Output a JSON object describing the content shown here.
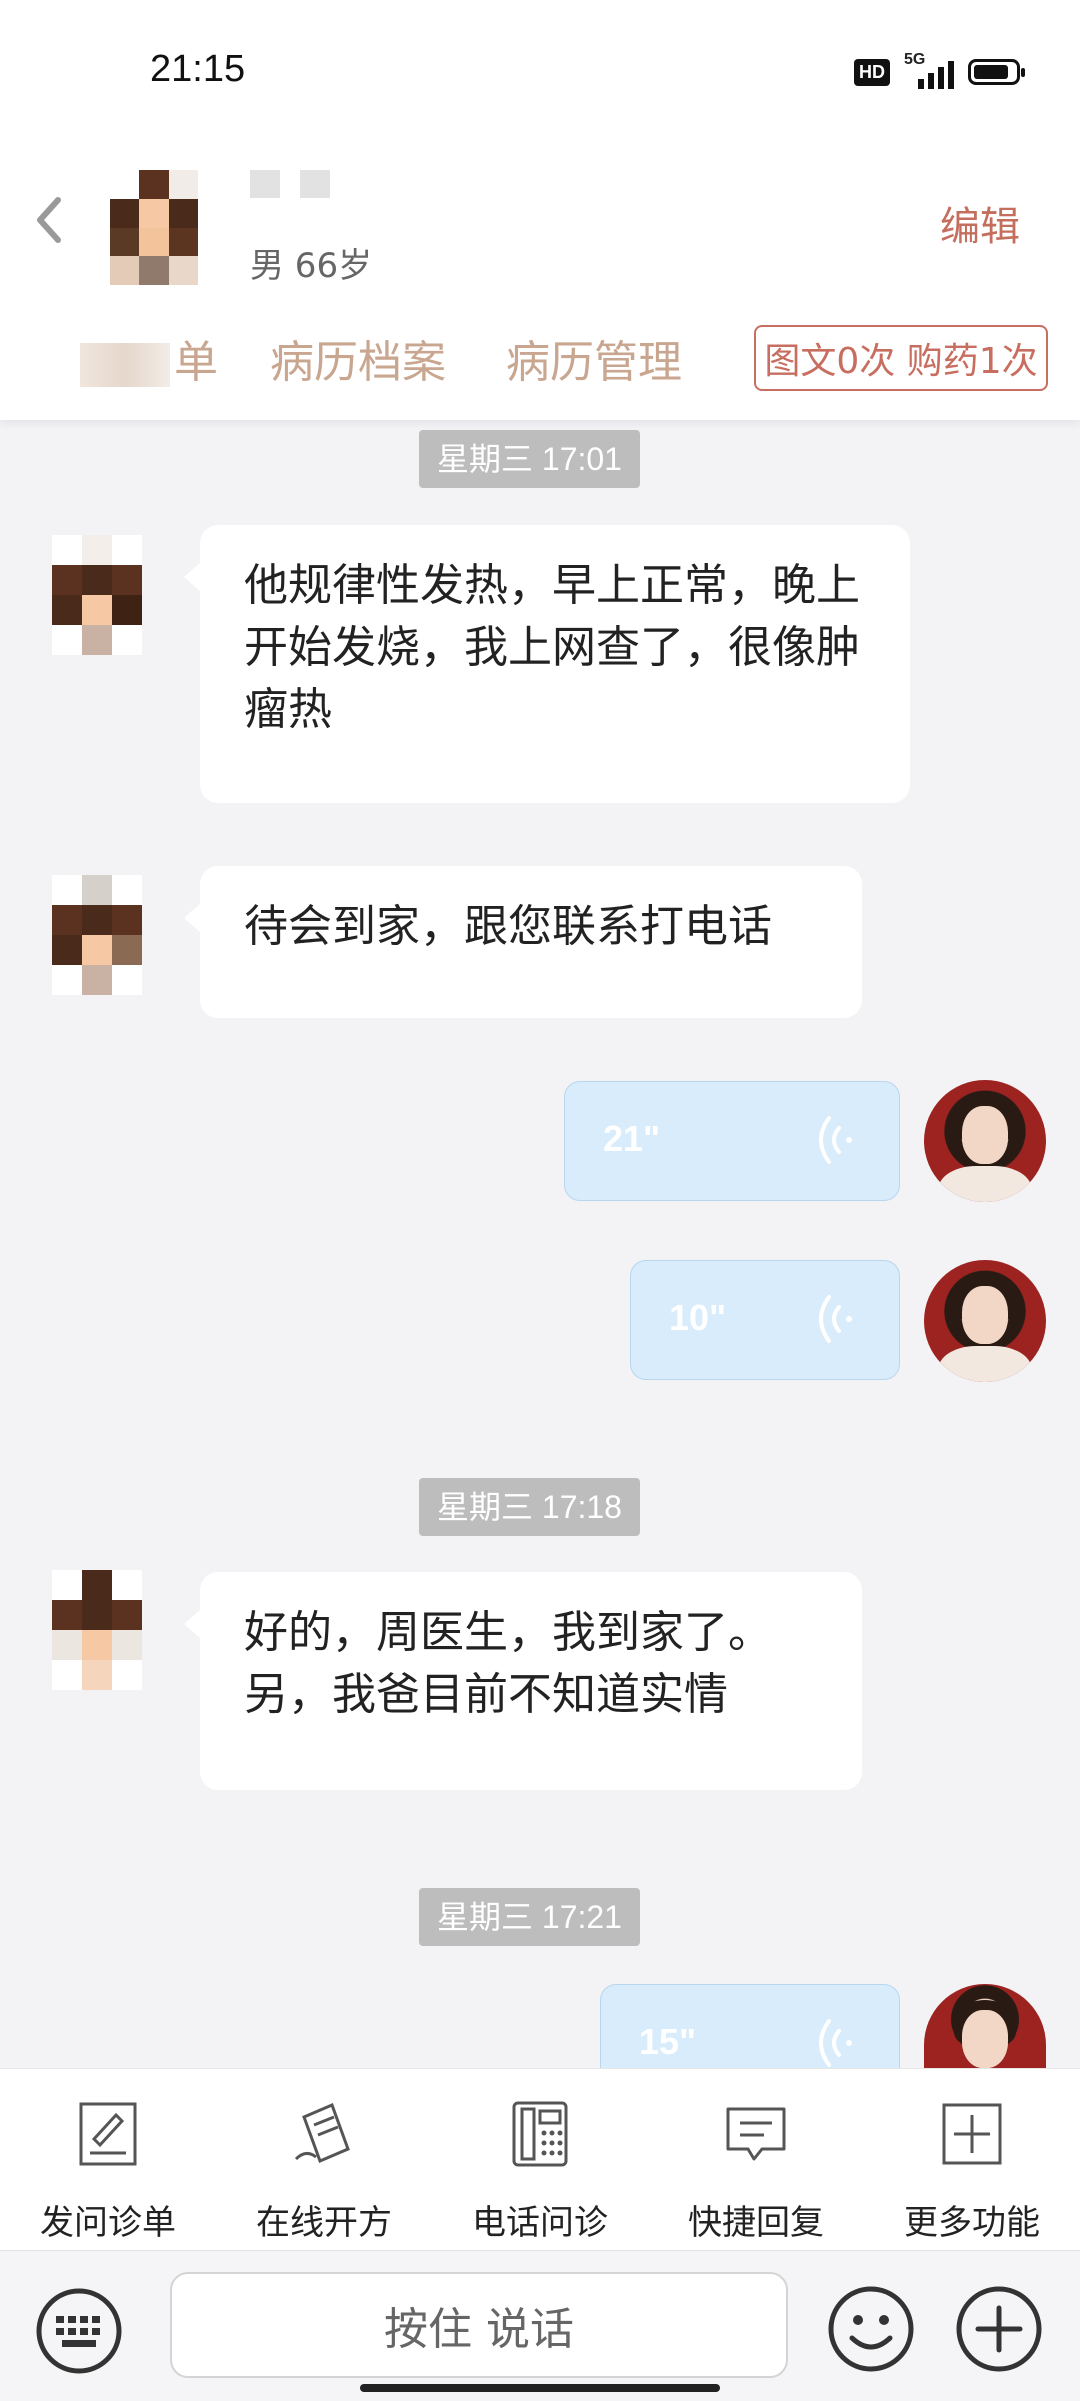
{
  "status_bar": {
    "time": "21:15",
    "hd": "HD",
    "network": "5G",
    "battery_percent": 85
  },
  "header": {
    "patient_info": "男 66岁",
    "edit_label": "编辑",
    "tabs": [
      {
        "label": "单"
      },
      {
        "label": "病历档案"
      },
      {
        "label": "病历管理"
      }
    ],
    "stats_badge": "图文0次 购药1次"
  },
  "chat": {
    "timestamps": [
      "星期三 17:01",
      "星期三 17:18",
      "星期三 17:21"
    ],
    "messages": [
      {
        "from": "patient",
        "text": "他规律性发热，早上正常，晚上开始发烧，我上网查了，很像肿瘤热"
      },
      {
        "from": "patient",
        "text": "待会到家，跟您联系打电话"
      },
      {
        "from": "doctor",
        "type": "voice",
        "duration": "21\""
      },
      {
        "from": "doctor",
        "type": "voice",
        "duration": "10\""
      },
      {
        "from": "patient",
        "text": "好的，周医生，我到家了。另，我爸目前不知道实情"
      },
      {
        "from": "doctor",
        "type": "voice",
        "duration": "15\""
      }
    ]
  },
  "toolbar": {
    "items": [
      {
        "label": "发问诊单",
        "icon": "form-pen-icon"
      },
      {
        "label": "在线开方",
        "icon": "prescription-icon"
      },
      {
        "label": "电话问诊",
        "icon": "phone-icon"
      },
      {
        "label": "快捷回复",
        "icon": "chat-bubble-icon"
      },
      {
        "label": "更多功能",
        "icon": "plus-box-icon"
      }
    ]
  },
  "input_bar": {
    "hold_to_talk": "按住 说话"
  },
  "colors": {
    "accent": "#c46e5d",
    "tab_text": "#c9a68f",
    "voice_bubble": "#d9ecfb",
    "time_chip": "#bdbdbd"
  }
}
